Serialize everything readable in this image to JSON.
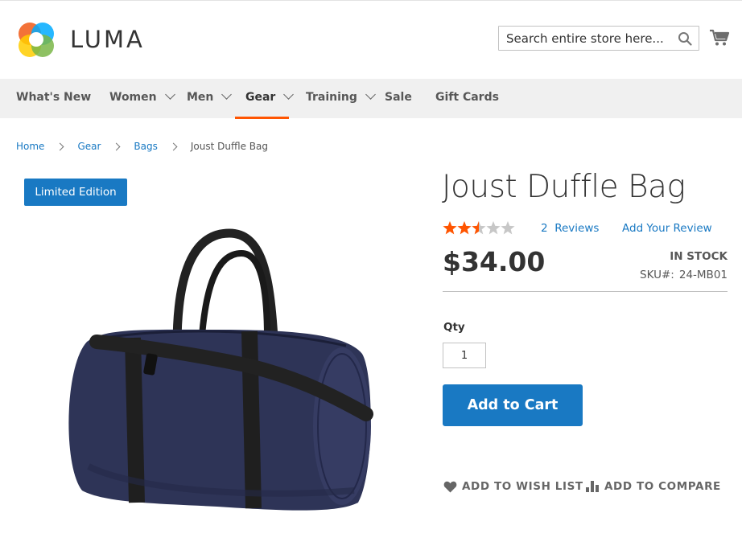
{
  "header": {
    "logo_text": "LUMA",
    "search_placeholder": "Search entire store here...",
    "icons": [
      "luma-logo-icon",
      "search-icon",
      "cart-icon"
    ]
  },
  "nav": {
    "items": [
      {
        "label": "What's New",
        "has_dropdown": false
      },
      {
        "label": "Women",
        "has_dropdown": true
      },
      {
        "label": "Men",
        "has_dropdown": true
      },
      {
        "label": "Gear",
        "has_dropdown": true,
        "active": true
      },
      {
        "label": "Training",
        "has_dropdown": true
      },
      {
        "label": "Sale",
        "has_dropdown": false
      },
      {
        "label": "Gift Cards",
        "has_dropdown": false
      }
    ],
    "active_color": "#ff5501"
  },
  "breadcrumb": {
    "items": [
      "Home",
      "Gear",
      "Bags"
    ],
    "current": "Joust Duffle Bag"
  },
  "product": {
    "badge": "Limited Edition",
    "title": "Joust Duffle Bag",
    "rating_stars": 2.5,
    "rating_max": 5,
    "reviews_count": "2",
    "reviews_word": "Reviews",
    "add_review": "Add Your Review",
    "price": "$34.00",
    "stock": "IN STOCK",
    "sku_label": "SKU#:",
    "sku": "24-MB01",
    "qty_label": "Qty",
    "qty_value": "1",
    "add_to_cart": "Add to Cart",
    "wish_list": "ADD TO WISH LIST",
    "compare": "ADD TO COMPARE"
  },
  "colors": {
    "accent": "#1979c3",
    "star": "#ff5501",
    "star_empty": "#c7c7c7",
    "nav_bg": "#f0f0f0",
    "bag_body": "#2e3457",
    "bag_strap": "#1f1f1f"
  }
}
